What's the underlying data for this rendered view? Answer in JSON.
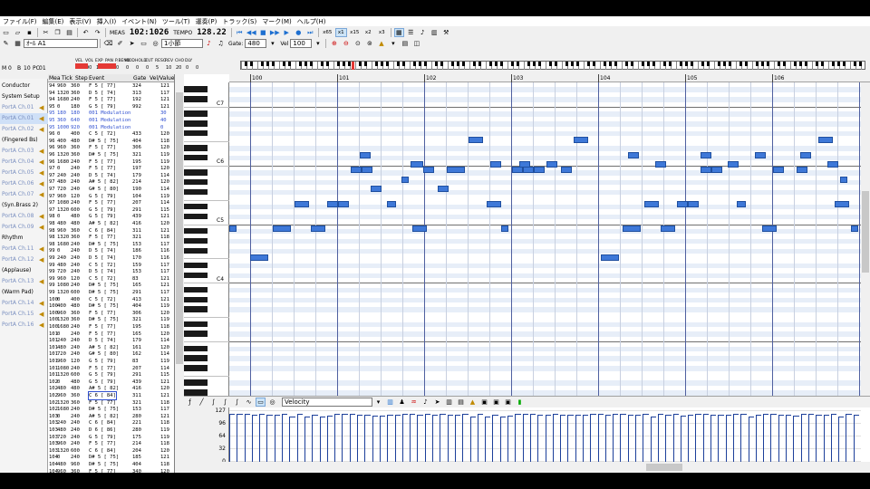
{
  "menu": [
    "ファイル(F)",
    "編集(E)",
    "表示(V)",
    "挿入(I)",
    "イベント(N)",
    "ツール(T)",
    "運奏(P)",
    "トラック(S)",
    "マーク(M)",
    "ヘルプ(H)"
  ],
  "toolbar1": {
    "meas_label": "MEAS",
    "position": "102:1026",
    "tempo_label": "TEMPO",
    "tempo": "128.22",
    "zoom": [
      "x65",
      "x1",
      "x15",
      "x2",
      "x3"
    ]
  },
  "toolbar2": {
    "track_select": "ｵｰﾙ A1",
    "measure_unit": "1小節",
    "gate_label": "Gate:",
    "gate_value": "480",
    "vel_label": "Vel",
    "vel_value": "100"
  },
  "ctrl_strip": {
    "labels": [
      "VEL",
      "VOL",
      "EXP",
      "PAN",
      "P.BEND",
      "MOD",
      "HOLD",
      "CUT",
      "RESO",
      "REV",
      "CHO",
      "DLY"
    ],
    "values": [
      "",
      "90",
      "127",
      "0",
      "0",
      "0",
      "0",
      "0",
      "5",
      "10",
      "20",
      "0",
      "0"
    ],
    "left_fields": [
      "M",
      "0",
      "B",
      "10",
      "PC",
      "01"
    ]
  },
  "tracks": [
    {
      "label": "Conductor",
      "type": "plain"
    },
    {
      "label": "System Setup",
      "type": "plain"
    },
    {
      "label": "PortA Ch.01",
      "type": "pa"
    },
    {
      "label": "PortA Ch.01",
      "type": "pa",
      "selected": true
    },
    {
      "label": "PortA Ch.02",
      "type": "pa"
    },
    {
      "label": "(Fingered Bs)",
      "type": "plain"
    },
    {
      "label": "PortA Ch.03",
      "type": "pa"
    },
    {
      "label": "PortA Ch.04",
      "type": "pa"
    },
    {
      "label": "PortA Ch.05",
      "type": "pa"
    },
    {
      "label": "PortA Ch.06",
      "type": "pa"
    },
    {
      "label": "PortA Ch.07",
      "type": "pa"
    },
    {
      "label": "(Syn.Brass 2)",
      "type": "plain"
    },
    {
      "label": "PortA Ch.08",
      "type": "pa"
    },
    {
      "label": "PortA Ch.09",
      "type": "pa"
    },
    {
      "label": "Rhythm",
      "type": "plain"
    },
    {
      "label": "PortA Ch.11",
      "type": "pa"
    },
    {
      "label": "PortA Ch.12",
      "type": "pa"
    },
    {
      "label": "(Applause)",
      "type": "plain"
    },
    {
      "label": "PortA Ch.13",
      "type": "pa"
    },
    {
      "label": "(Warm Pad)",
      "type": "plain"
    },
    {
      "label": "PortA Ch.14",
      "type": "pa"
    },
    {
      "label": "PortA Ch.15",
      "type": "pa"
    },
    {
      "label": "PortA Ch.16",
      "type": "pa"
    }
  ],
  "event_header": [
    "Mea",
    "Tick",
    "Step",
    "Event",
    "Gate",
    "Vel/Value"
  ],
  "events": [
    [
      "94",
      "960",
      "360",
      "F  5 [ 77]",
      "324",
      "121"
    ],
    [
      "94",
      "1320",
      "360",
      "D  5 [ 74]",
      "313",
      "117"
    ],
    [
      "94",
      "1680",
      "240",
      "F  5 [ 77]",
      "192",
      "121"
    ],
    [
      "95",
      "0",
      "180",
      "G  5 [ 79]",
      "992",
      "121"
    ],
    [
      "95",
      "180",
      "180",
      "001 Modulation",
      "",
      "30"
    ],
    [
      "95",
      "360",
      "640",
      "001 Modulation",
      "",
      "40"
    ],
    [
      "95",
      "1000",
      "920",
      "001 Modulation",
      "",
      "0"
    ],
    [
      "96",
      "0",
      "400",
      "C  5 [ 72]",
      "433",
      "120"
    ],
    [
      "96",
      "400",
      "480",
      "D# 5 [ 75]",
      "404",
      "118"
    ],
    [
      "96",
      "960",
      "360",
      "F  5 [ 77]",
      "306",
      "120"
    ],
    [
      "96",
      "1320",
      "360",
      "D# 5 [ 75]",
      "321",
      "119"
    ],
    [
      "96",
      "1680",
      "240",
      "F  5 [ 77]",
      "195",
      "119"
    ],
    [
      "97",
      "0",
      "240",
      "F  5 [ 77]",
      "197",
      "120"
    ],
    [
      "97",
      "240",
      "240",
      "D  5 [ 74]",
      "179",
      "114"
    ],
    [
      "97",
      "480",
      "240",
      "A# 5 [ 82]",
      "214",
      "120"
    ],
    [
      "97",
      "720",
      "240",
      "G# 5 [ 80]",
      "190",
      "114"
    ],
    [
      "97",
      "960",
      "120",
      "G  5 [ 79]",
      "104",
      "119"
    ],
    [
      "97",
      "1080",
      "240",
      "F  5 [ 77]",
      "207",
      "114"
    ],
    [
      "97",
      "1320",
      "600",
      "G  5 [ 79]",
      "291",
      "115"
    ],
    [
      "98",
      "0",
      "480",
      "G  5 [ 79]",
      "439",
      "121"
    ],
    [
      "98",
      "480",
      "480",
      "A# 5 [ 82]",
      "416",
      "120"
    ],
    [
      "98",
      "960",
      "360",
      "C  6 [ 84]",
      "311",
      "121"
    ],
    [
      "98",
      "1320",
      "360",
      "F  5 [ 77]",
      "321",
      "118"
    ],
    [
      "98",
      "1680",
      "240",
      "D# 5 [ 75]",
      "153",
      "117"
    ],
    [
      "99",
      "0",
      "240",
      "D  5 [ 74]",
      "186",
      "116"
    ],
    [
      "99",
      "240",
      "240",
      "D  5 [ 74]",
      "170",
      "116"
    ],
    [
      "99",
      "480",
      "240",
      "C  5 [ 72]",
      "159",
      "117"
    ],
    [
      "99",
      "720",
      "240",
      "D  5 [ 74]",
      "153",
      "117"
    ],
    [
      "99",
      "960",
      "120",
      "C  5 [ 72]",
      "83",
      "121"
    ],
    [
      "99",
      "1080",
      "240",
      "D# 5 [ 75]",
      "165",
      "121"
    ],
    [
      "99",
      "1320",
      "600",
      "D# 5 [ 75]",
      "291",
      "117"
    ],
    [
      "100",
      "0",
      "400",
      "C  5 [ 72]",
      "413",
      "121"
    ],
    [
      "100",
      "400",
      "480",
      "D# 5 [ 75]",
      "404",
      "119"
    ],
    [
      "100",
      "960",
      "360",
      "F  5 [ 77]",
      "306",
      "120"
    ],
    [
      "100",
      "1320",
      "360",
      "D# 5 [ 75]",
      "321",
      "119"
    ],
    [
      "100",
      "1680",
      "240",
      "F  5 [ 77]",
      "195",
      "118"
    ],
    [
      "101",
      "0",
      "240",
      "F  5 [ 77]",
      "165",
      "120"
    ],
    [
      "101",
      "240",
      "240",
      "D  5 [ 74]",
      "179",
      "114"
    ],
    [
      "101",
      "480",
      "240",
      "A# 5 [ 82]",
      "161",
      "120"
    ],
    [
      "101",
      "720",
      "240",
      "G# 5 [ 80]",
      "162",
      "114"
    ],
    [
      "101",
      "960",
      "120",
      "G  5 [ 79]",
      "83",
      "119"
    ],
    [
      "101",
      "1080",
      "240",
      "F  5 [ 77]",
      "207",
      "114"
    ],
    [
      "101",
      "1320",
      "600",
      "G  5 [ 79]",
      "291",
      "115"
    ],
    [
      "102",
      "0",
      "480",
      "G  5 [ 79]",
      "439",
      "121"
    ],
    [
      "102",
      "480",
      "480",
      "A# 5 [ 82]",
      "416",
      "120"
    ],
    [
      "102",
      "960",
      "360",
      "C  6 [ 84]",
      "311",
      "121"
    ],
    [
      "102",
      "1320",
      "360",
      "F  5 [ 77]",
      "321",
      "118"
    ],
    [
      "102",
      "1680",
      "240",
      "D# 5 [ 75]",
      "153",
      "117"
    ],
    [
      "103",
      "0",
      "240",
      "A# 5 [ 82]",
      "280",
      "121"
    ],
    [
      "103",
      "240",
      "240",
      "C  6 [ 84]",
      "221",
      "118"
    ],
    [
      "103",
      "480",
      "240",
      "D  6 [ 86]",
      "280",
      "119"
    ],
    [
      "103",
      "720",
      "240",
      "G  5 [ 79]",
      "175",
      "119"
    ],
    [
      "103",
      "960",
      "240",
      "F  5 [ 77]",
      "214",
      "118"
    ],
    [
      "103",
      "1320",
      "600",
      "C  6 [ 84]",
      "204",
      "120"
    ],
    [
      "104",
      "0",
      "240",
      "D# 5 [ 75]",
      "185",
      "121"
    ],
    [
      "104",
      "480",
      "960",
      "D# 5 [ 75]",
      "404",
      "118"
    ],
    [
      "104",
      "960",
      "360",
      "F  5 [ 77]",
      "340",
      "120"
    ]
  ],
  "ruler": [
    "100",
    "101",
    "102",
    "103",
    "104",
    "105",
    "106"
  ],
  "octaves": [
    "C7",
    "C6",
    "C5",
    "C4"
  ],
  "vel_toolbar": {
    "select": "Velocity"
  },
  "vel_axis": [
    "127",
    "96",
    "64",
    "32",
    "0"
  ],
  "colors": {
    "note": "#3e78d8",
    "bar": "#1c3f9a",
    "accent": "#e53935"
  },
  "notes": [
    [
      0,
      59,
      8
    ],
    [
      23,
      53,
      20
    ],
    [
      48,
      59,
      20
    ],
    [
      72,
      64,
      16
    ],
    [
      90,
      59,
      16
    ],
    [
      108,
      64,
      12
    ],
    [
      120,
      64,
      12
    ],
    [
      134,
      71,
      12
    ],
    [
      146,
      71,
      12
    ],
    [
      174,
      64,
      10
    ],
    [
      202,
      59,
      16
    ],
    [
      214,
      71,
      12
    ],
    [
      240,
      71,
      20
    ],
    [
      264,
      77,
      16
    ],
    [
      284,
      64,
      16
    ],
    [
      300,
      59,
      8
    ],
    [
      312,
      71,
      12
    ],
    [
      324,
      71,
      12
    ],
    [
      336,
      71,
      12
    ],
    [
      366,
      71,
      12
    ],
    [
      380,
      77,
      16
    ],
    [
      410,
      53,
      20
    ],
    [
      434,
      59,
      20
    ],
    [
      458,
      64,
      16
    ],
    [
      476,
      59,
      16
    ],
    [
      494,
      64,
      12
    ],
    [
      506,
      64,
      12
    ],
    [
      520,
      71,
      12
    ],
    [
      532,
      71,
      12
    ],
    [
      560,
      64,
      10
    ],
    [
      588,
      59,
      16
    ],
    [
      600,
      71,
      12
    ],
    [
      626,
      71,
      12
    ],
    [
      650,
      77,
      16
    ],
    [
      668,
      64,
      16
    ],
    [
      686,
      59,
      8
    ],
    [
      144,
      74,
      12
    ],
    [
      156,
      67,
      12
    ],
    [
      190,
      69,
      8
    ],
    [
      230,
      67,
      12
    ],
    [
      200,
      72,
      14
    ],
    [
      288,
      72,
      12
    ],
    [
      320,
      72,
      12
    ],
    [
      350,
      72,
      12
    ],
    [
      440,
      74,
      12
    ],
    [
      470,
      72,
      12
    ],
    [
      520,
      74,
      12
    ],
    [
      550,
      72,
      12
    ],
    [
      580,
      74,
      12
    ],
    [
      630,
      74,
      12
    ],
    [
      660,
      72,
      12
    ],
    [
      674,
      69,
      8
    ]
  ],
  "velocities": [
    121,
    121,
    120,
    118,
    120,
    119,
    119,
    120,
    114,
    120,
    114,
    119,
    114,
    115,
    121,
    120,
    121,
    118,
    117,
    116,
    116,
    117,
    117,
    121,
    121,
    117,
    121,
    119,
    120,
    119,
    118,
    120,
    114,
    120,
    114,
    119,
    114,
    115,
    121,
    120,
    121,
    118,
    117,
    121,
    118,
    119,
    119,
    118,
    120,
    121,
    118,
    120,
    121,
    117,
    119,
    120,
    114,
    121,
    118,
    120,
    115,
    117,
    121,
    120,
    119,
    118,
    117,
    121,
    120,
    114,
    119,
    120,
    121,
    118,
    117,
    116,
    120,
    121,
    119,
    118,
    120,
    114,
    121,
    117
  ]
}
